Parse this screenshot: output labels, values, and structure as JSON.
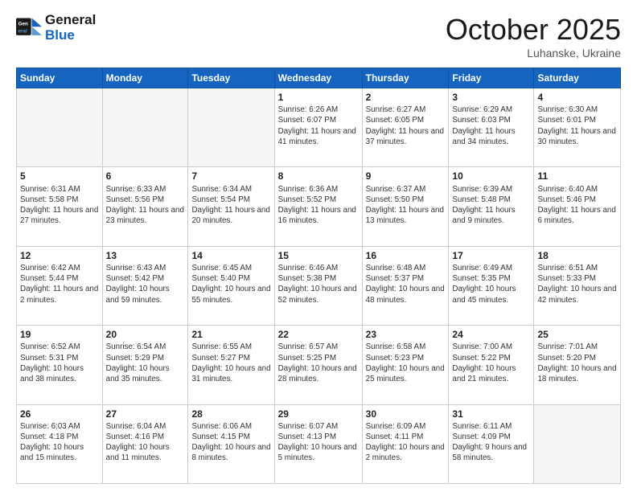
{
  "header": {
    "logo_line1": "General",
    "logo_line2": "Blue",
    "month": "October 2025",
    "location": "Luhanske, Ukraine"
  },
  "weekdays": [
    "Sunday",
    "Monday",
    "Tuesday",
    "Wednesday",
    "Thursday",
    "Friday",
    "Saturday"
  ],
  "weeks": [
    [
      {
        "day": "",
        "info": ""
      },
      {
        "day": "",
        "info": ""
      },
      {
        "day": "",
        "info": ""
      },
      {
        "day": "1",
        "info": "Sunrise: 6:26 AM\nSunset: 6:07 PM\nDaylight: 11 hours\nand 41 minutes."
      },
      {
        "day": "2",
        "info": "Sunrise: 6:27 AM\nSunset: 6:05 PM\nDaylight: 11 hours\nand 37 minutes."
      },
      {
        "day": "3",
        "info": "Sunrise: 6:29 AM\nSunset: 6:03 PM\nDaylight: 11 hours\nand 34 minutes."
      },
      {
        "day": "4",
        "info": "Sunrise: 6:30 AM\nSunset: 6:01 PM\nDaylight: 11 hours\nand 30 minutes."
      }
    ],
    [
      {
        "day": "5",
        "info": "Sunrise: 6:31 AM\nSunset: 5:58 PM\nDaylight: 11 hours\nand 27 minutes."
      },
      {
        "day": "6",
        "info": "Sunrise: 6:33 AM\nSunset: 5:56 PM\nDaylight: 11 hours\nand 23 minutes."
      },
      {
        "day": "7",
        "info": "Sunrise: 6:34 AM\nSunset: 5:54 PM\nDaylight: 11 hours\nand 20 minutes."
      },
      {
        "day": "8",
        "info": "Sunrise: 6:36 AM\nSunset: 5:52 PM\nDaylight: 11 hours\nand 16 minutes."
      },
      {
        "day": "9",
        "info": "Sunrise: 6:37 AM\nSunset: 5:50 PM\nDaylight: 11 hours\nand 13 minutes."
      },
      {
        "day": "10",
        "info": "Sunrise: 6:39 AM\nSunset: 5:48 PM\nDaylight: 11 hours\nand 9 minutes."
      },
      {
        "day": "11",
        "info": "Sunrise: 6:40 AM\nSunset: 5:46 PM\nDaylight: 11 hours\nand 6 minutes."
      }
    ],
    [
      {
        "day": "12",
        "info": "Sunrise: 6:42 AM\nSunset: 5:44 PM\nDaylight: 11 hours\nand 2 minutes."
      },
      {
        "day": "13",
        "info": "Sunrise: 6:43 AM\nSunset: 5:42 PM\nDaylight: 10 hours\nand 59 minutes."
      },
      {
        "day": "14",
        "info": "Sunrise: 6:45 AM\nSunset: 5:40 PM\nDaylight: 10 hours\nand 55 minutes."
      },
      {
        "day": "15",
        "info": "Sunrise: 6:46 AM\nSunset: 5:38 PM\nDaylight: 10 hours\nand 52 minutes."
      },
      {
        "day": "16",
        "info": "Sunrise: 6:48 AM\nSunset: 5:37 PM\nDaylight: 10 hours\nand 48 minutes."
      },
      {
        "day": "17",
        "info": "Sunrise: 6:49 AM\nSunset: 5:35 PM\nDaylight: 10 hours\nand 45 minutes."
      },
      {
        "day": "18",
        "info": "Sunrise: 6:51 AM\nSunset: 5:33 PM\nDaylight: 10 hours\nand 42 minutes."
      }
    ],
    [
      {
        "day": "19",
        "info": "Sunrise: 6:52 AM\nSunset: 5:31 PM\nDaylight: 10 hours\nand 38 minutes."
      },
      {
        "day": "20",
        "info": "Sunrise: 6:54 AM\nSunset: 5:29 PM\nDaylight: 10 hours\nand 35 minutes."
      },
      {
        "day": "21",
        "info": "Sunrise: 6:55 AM\nSunset: 5:27 PM\nDaylight: 10 hours\nand 31 minutes."
      },
      {
        "day": "22",
        "info": "Sunrise: 6:57 AM\nSunset: 5:25 PM\nDaylight: 10 hours\nand 28 minutes."
      },
      {
        "day": "23",
        "info": "Sunrise: 6:58 AM\nSunset: 5:23 PM\nDaylight: 10 hours\nand 25 minutes."
      },
      {
        "day": "24",
        "info": "Sunrise: 7:00 AM\nSunset: 5:22 PM\nDaylight: 10 hours\nand 21 minutes."
      },
      {
        "day": "25",
        "info": "Sunrise: 7:01 AM\nSunset: 5:20 PM\nDaylight: 10 hours\nand 18 minutes."
      }
    ],
    [
      {
        "day": "26",
        "info": "Sunrise: 6:03 AM\nSunset: 4:18 PM\nDaylight: 10 hours\nand 15 minutes."
      },
      {
        "day": "27",
        "info": "Sunrise: 6:04 AM\nSunset: 4:16 PM\nDaylight: 10 hours\nand 11 minutes."
      },
      {
        "day": "28",
        "info": "Sunrise: 6:06 AM\nSunset: 4:15 PM\nDaylight: 10 hours\nand 8 minutes."
      },
      {
        "day": "29",
        "info": "Sunrise: 6:07 AM\nSunset: 4:13 PM\nDaylight: 10 hours\nand 5 minutes."
      },
      {
        "day": "30",
        "info": "Sunrise: 6:09 AM\nSunset: 4:11 PM\nDaylight: 10 hours\nand 2 minutes."
      },
      {
        "day": "31",
        "info": "Sunrise: 6:11 AM\nSunset: 4:09 PM\nDaylight: 9 hours\nand 58 minutes."
      },
      {
        "day": "",
        "info": ""
      }
    ]
  ]
}
